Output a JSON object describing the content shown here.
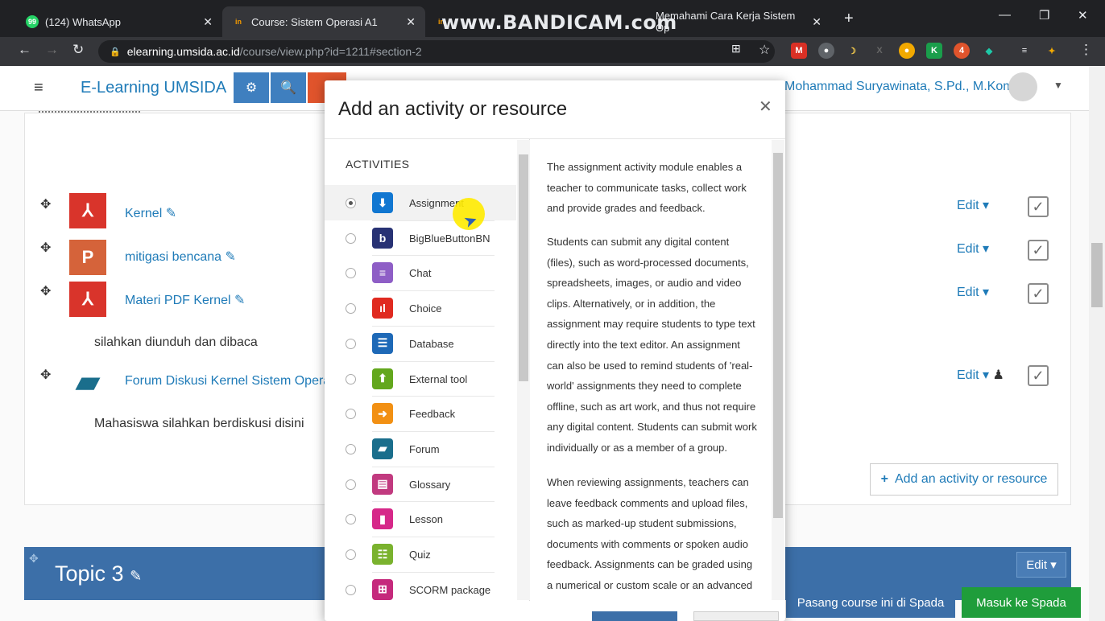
{
  "browser": {
    "tabs": [
      {
        "title": "(124) WhatsApp",
        "favicon_text": "99"
      },
      {
        "title": "Course: Sistem Operasi A1",
        "favicon_text": "in"
      },
      {
        "title": "Memahami Cara Kerja Sistem Op",
        "favicon_text": "in"
      }
    ],
    "watermark": "www.BANDICAM.com",
    "url_host": "elearning.umsida.ac.id",
    "url_path": "/course/view.php?id=1211#section-2"
  },
  "navbar": {
    "brand": "E-Learning UMSIDA",
    "user_name": "Mohammad Suryawinata, S.Pd., M.Kom"
  },
  "activities": [
    {
      "name": "Kernel",
      "icon": "pdf-icon"
    },
    {
      "name": "mitigasi bencana",
      "icon": "powerpoint-icon"
    },
    {
      "name": "Materi PDF Kernel",
      "icon": "pdf-icon"
    },
    {
      "name": "Forum Diskusi Kernel Sistem Opera",
      "icon": "forum-icon"
    }
  ],
  "descriptions": {
    "materi": "silahkan diunduh dan dibaca",
    "forum": "Mahasiswa silahkan berdiskusi disini"
  },
  "edit_label": "Edit",
  "add_activity_label": "Add an activity or resource",
  "topic": {
    "title": "Topic 3",
    "edit_label": "Edit"
  },
  "spada": {
    "pasang": "Pasang course ini di Spada",
    "masuk": "Masuk ke Spada"
  },
  "modal": {
    "title": "Add an activity or resource",
    "category": "ACTIVITIES",
    "options": [
      {
        "label": "Assignment",
        "icon": "assignment-icon",
        "color": "#1177d1",
        "selected": true
      },
      {
        "label": "BigBlueButtonBN",
        "icon": "bigbluebutton-icon",
        "color": "#283274",
        "selected": false
      },
      {
        "label": "Chat",
        "icon": "chat-icon",
        "color": "#8e5ec6",
        "selected": false
      },
      {
        "label": "Choice",
        "icon": "choice-icon",
        "color": "#e02a20",
        "selected": false
      },
      {
        "label": "Database",
        "icon": "database-icon",
        "color": "#1e69b7",
        "selected": false
      },
      {
        "label": "External tool",
        "icon": "external-tool-icon",
        "color": "#63a71d",
        "selected": false
      },
      {
        "label": "Feedback",
        "icon": "feedback-icon",
        "color": "#f29013",
        "selected": false
      },
      {
        "label": "Forum",
        "icon": "forum-icon",
        "color": "#1a6e8c",
        "selected": false
      },
      {
        "label": "Glossary",
        "icon": "glossary-icon",
        "color": "#c13a7f",
        "selected": false
      },
      {
        "label": "Lesson",
        "icon": "lesson-icon",
        "color": "#d62889",
        "selected": false
      },
      {
        "label": "Quiz",
        "icon": "quiz-icon",
        "color": "#7ab22e",
        "selected": false
      },
      {
        "label": "SCORM package",
        "icon": "scorm-icon",
        "color": "#c5297c",
        "selected": false
      }
    ],
    "help": [
      "The assignment activity module enables a teacher to communicate tasks, collect work and provide grades and feedback.",
      "Students can submit any digital content (files), such as word-processed documents, spreadsheets, images, or audio and video clips. Alternatively, or in addition, the assignment may require students to type text directly into the text editor. An assignment can also be used to remind students of 'real-world' assignments they need to complete offline, such as art work, and thus not require any digital content. Students can submit work individually or as a member of a group.",
      "When reviewing assignments, teachers can leave feedback comments and upload files, such as marked-up student submissions, documents with comments or spoken audio feedback. Assignments can be graded using a numerical or custom scale or an advanced"
    ]
  }
}
